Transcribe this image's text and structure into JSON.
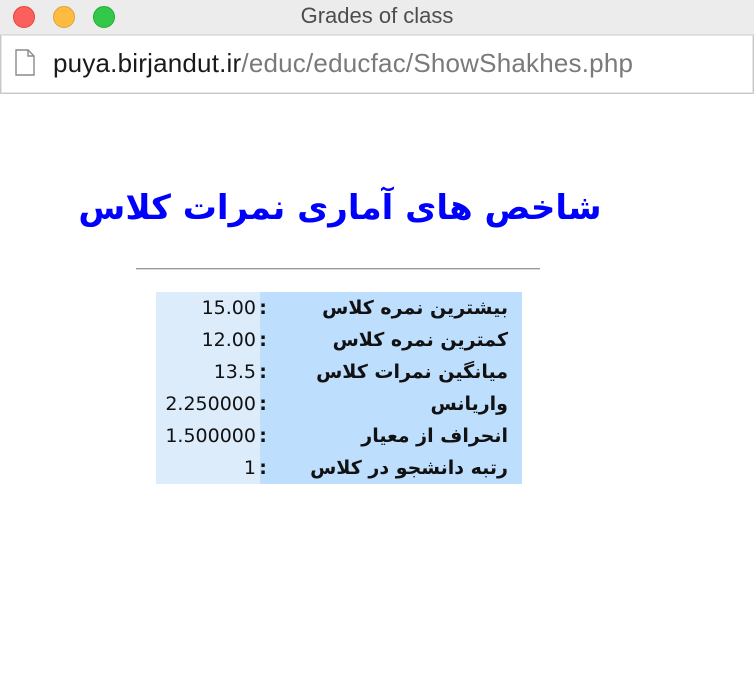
{
  "window": {
    "title": "Grades of class"
  },
  "browser": {
    "url_host": "puya.birjandut.ir",
    "url_path": "/educ/educfac/ShowShakhes.php",
    "page_icon": "document-icon"
  },
  "page": {
    "heading": "شاخص های آماری نمرات کلاس",
    "separator": ":",
    "stats": [
      {
        "label": "بیشترین نمره کلاس",
        "value": "15.00"
      },
      {
        "label": "کمترین نمره کلاس",
        "value": "12.00"
      },
      {
        "label": "میانگین نمرات کلاس",
        "value": "13.5"
      },
      {
        "label": "واریانس",
        "value": "2.250000"
      },
      {
        "label": "انحراف از معیار",
        "value": "1.500000"
      },
      {
        "label": "رتبه دانشجو در کلاس",
        "value": "1"
      }
    ]
  },
  "colors": {
    "heading": "#0000ff",
    "value_bg": "#dcecfb",
    "label_bg": "#bedefe"
  }
}
